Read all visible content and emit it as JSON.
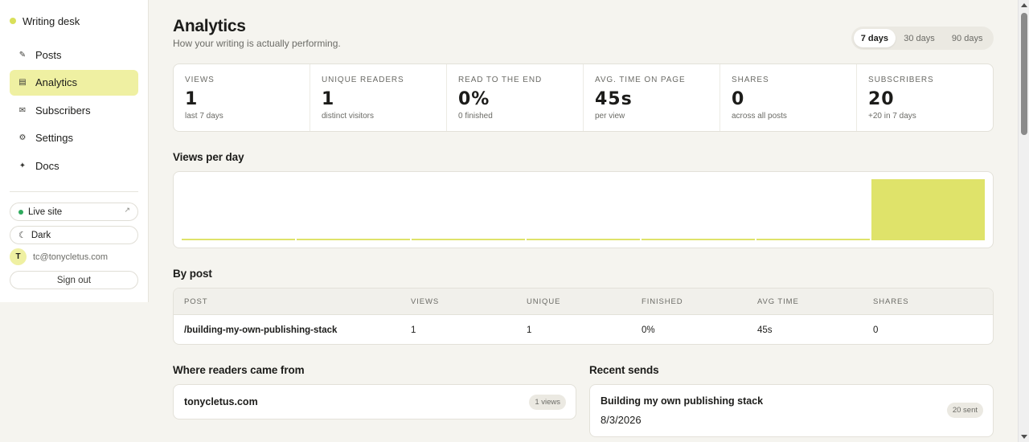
{
  "app": {
    "brand": "Writing desk",
    "brand_color": "#d9e05a",
    "accent": "#eff0a2"
  },
  "sidebar": {
    "nav": [
      {
        "label": "Posts",
        "icon": "pen-icon",
        "glyph": "✎"
      },
      {
        "label": "Analytics",
        "icon": "chart-icon",
        "glyph": "▤",
        "active": true
      },
      {
        "label": "Subscribers",
        "icon": "mail-icon",
        "glyph": "✉"
      },
      {
        "label": "Settings",
        "icon": "gear-icon",
        "glyph": "⚙"
      },
      {
        "label": "Docs",
        "icon": "sparkle-icon",
        "glyph": "✦"
      }
    ],
    "live_site": "Live site",
    "theme": "Dark",
    "user_initial": "T",
    "user_email": "tc@tonycletus.com",
    "sign_out": "Sign out"
  },
  "header": {
    "title": "Analytics",
    "subtitle": "How your writing is actually performing.",
    "ranges": [
      "7 days",
      "30 days",
      "90 days"
    ],
    "active_range": "7 days"
  },
  "stats": [
    {
      "label": "Views",
      "value": "1",
      "sub": "last 7 days"
    },
    {
      "label": "Unique readers",
      "value": "1",
      "sub": "distinct visitors"
    },
    {
      "label": "Read to the end",
      "value": "0%",
      "sub": "0 finished"
    },
    {
      "label": "Avg. time on page",
      "value": "45s",
      "sub": "per view"
    },
    {
      "label": "Shares",
      "value": "0",
      "sub": "across all posts"
    },
    {
      "label": "Subscribers",
      "value": "20",
      "sub": "+20 in 7 days"
    }
  ],
  "views_section": {
    "title": "Views per day",
    "chart_data": {
      "type": "bar",
      "categories": [
        "",
        "",
        "",
        "",
        "",
        "",
        ""
      ],
      "values": [
        0,
        0,
        0,
        0,
        0,
        0,
        1
      ],
      "color": "#dfe36a",
      "ylim": [
        0,
        1
      ],
      "grid": false
    }
  },
  "by_post": {
    "title": "By post",
    "columns": [
      "Post",
      "Views",
      "Unique",
      "Finished",
      "Avg time",
      "Shares"
    ],
    "rows": [
      [
        "/building-my-own-publishing-stack",
        "1",
        "1",
        "0%",
        "45s",
        "0"
      ]
    ]
  },
  "referrers": {
    "title": "Where readers came from",
    "items": [
      {
        "name": "tonycletus.com",
        "count": "1 views"
      }
    ]
  },
  "recent_sends": {
    "title": "Recent sends",
    "items": [
      {
        "title": "Building my own publishing stack",
        "date": "8/3/2026",
        "count": "20 sent"
      }
    ]
  }
}
